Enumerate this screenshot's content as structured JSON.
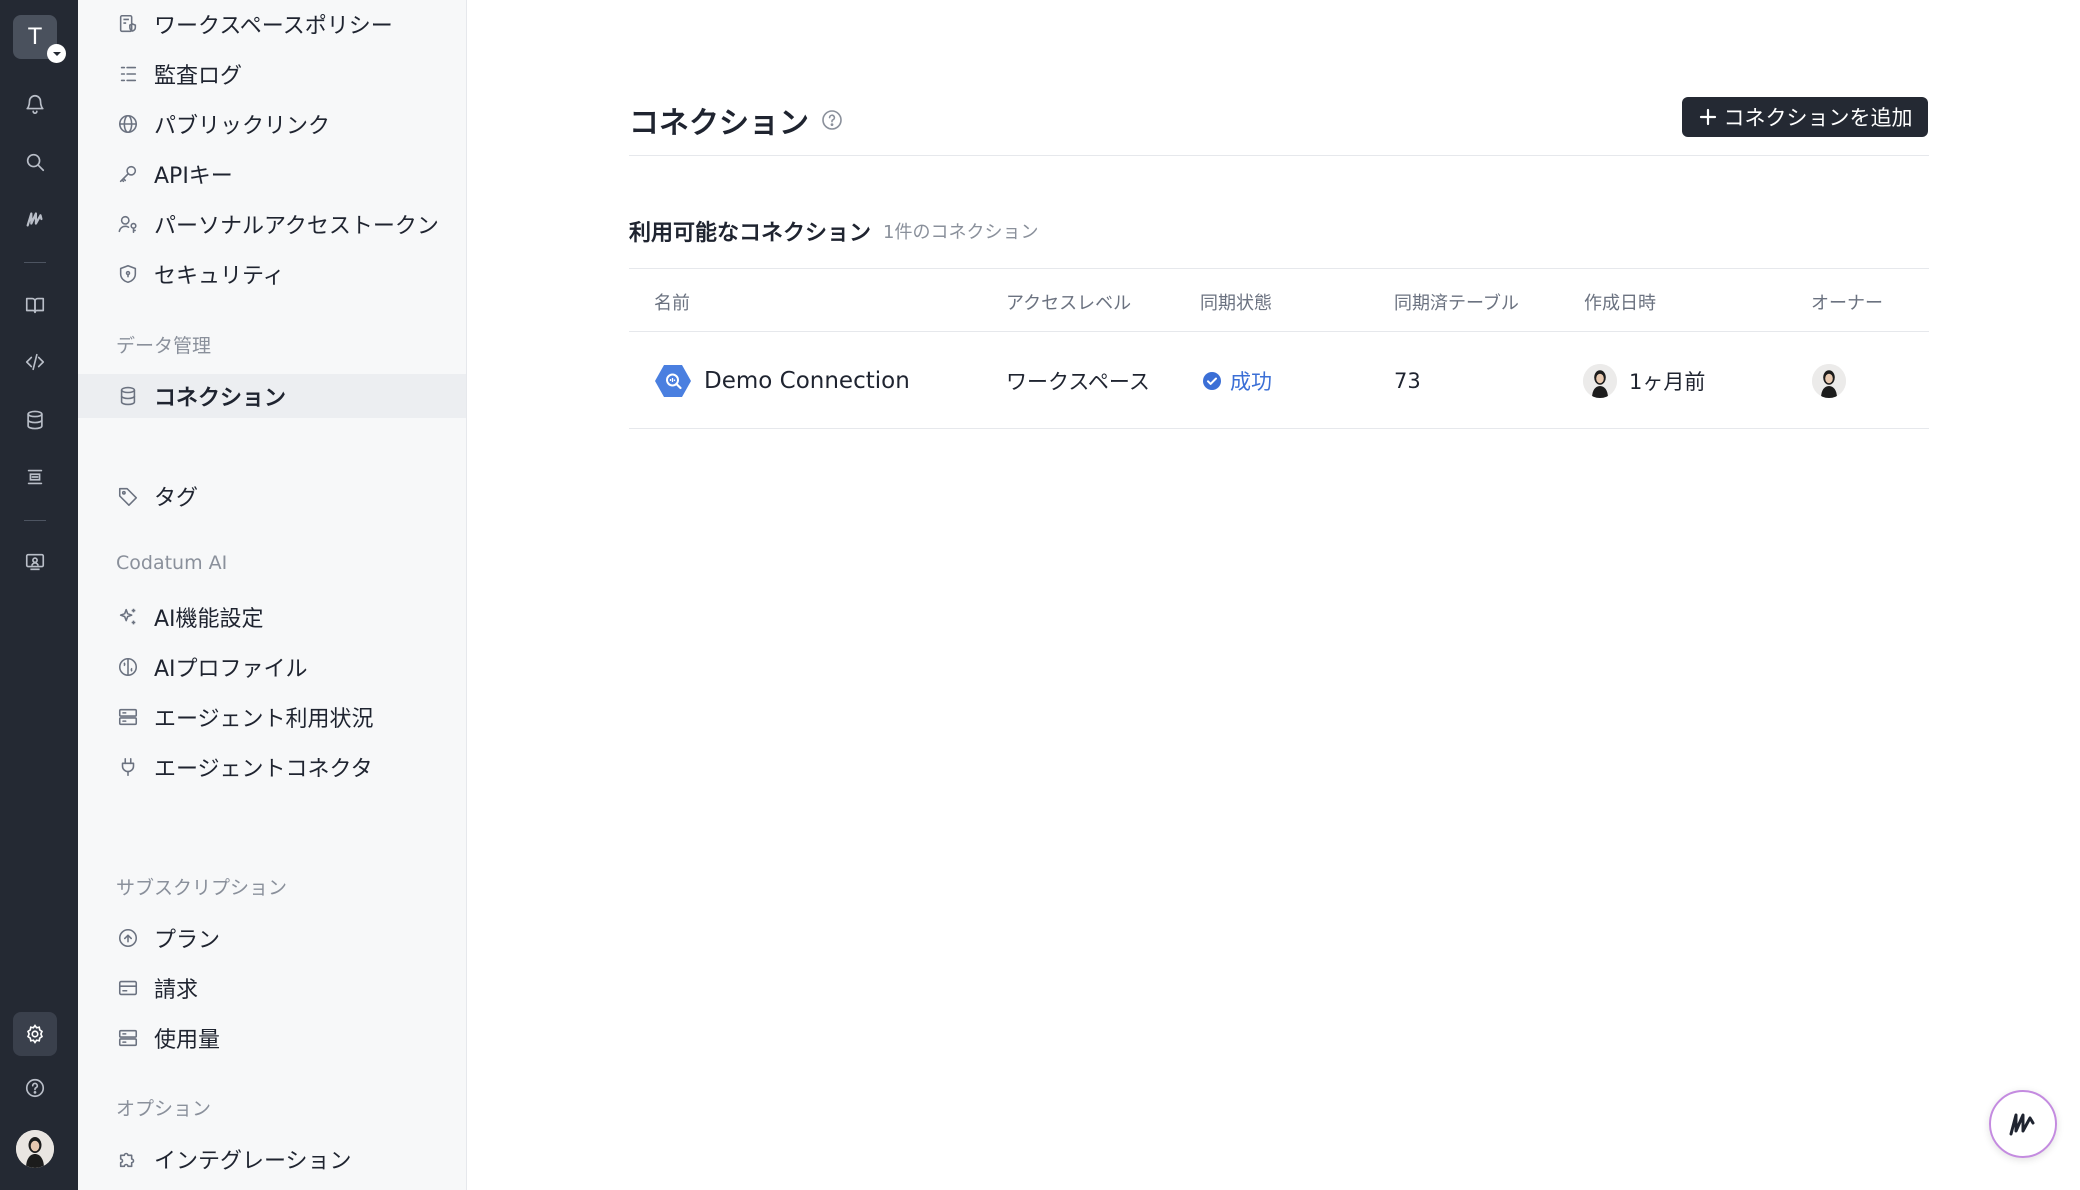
{
  "rail": {
    "workspace_initial": "T",
    "items": [
      {
        "name": "notifications",
        "icon": "bell-icon"
      },
      {
        "name": "search",
        "icon": "search-icon"
      },
      {
        "name": "codatum-home",
        "icon": "codatum-logo-icon"
      },
      {
        "name": "notebooks",
        "icon": "book-icon"
      },
      {
        "name": "sql",
        "icon": "code-icon"
      },
      {
        "name": "data",
        "icon": "database-icon"
      },
      {
        "name": "dashboards",
        "icon": "layers-icon"
      },
      {
        "name": "reports",
        "icon": "presentation-icon"
      },
      {
        "name": "settings",
        "icon": "gear-icon"
      },
      {
        "name": "help",
        "icon": "help-circle-icon"
      }
    ]
  },
  "sidebar": {
    "items_top": [
      {
        "label": "ワークスペースポリシー",
        "icon": "policy-icon"
      },
      {
        "label": "監査ログ",
        "icon": "list-icon"
      },
      {
        "label": "パブリックリンク",
        "icon": "globe-icon"
      },
      {
        "label": "APIキー",
        "icon": "key-icon"
      },
      {
        "label": "パーソナルアクセストークン",
        "icon": "user-key-icon"
      },
      {
        "label": "セキュリティ",
        "icon": "shield-icon"
      }
    ],
    "data_section": {
      "label": "データ管理",
      "items": [
        {
          "label": "コネクション",
          "icon": "database-icon"
        },
        {
          "label": "タグ",
          "icon": "tag-icon"
        }
      ]
    },
    "ai_section": {
      "label": "Codatum AI",
      "items": [
        {
          "label": "AI機能設定",
          "icon": "sparkles-icon"
        },
        {
          "label": "AIプロファイル",
          "icon": "brain-icon"
        },
        {
          "label": "エージェント利用状況",
          "icon": "server-icon"
        },
        {
          "label": "エージェントコネクタ",
          "icon": "plug-icon"
        }
      ]
    },
    "subscription_section": {
      "label": "サブスクリプション",
      "items": [
        {
          "label": "プラン",
          "icon": "arrow-up-circle-icon"
        },
        {
          "label": "請求",
          "icon": "credit-card-icon"
        },
        {
          "label": "使用量",
          "icon": "server-icon"
        }
      ]
    },
    "options_section": {
      "label": "オプション",
      "items": [
        {
          "label": "インテグレーション",
          "icon": "puzzle-icon"
        }
      ]
    }
  },
  "main": {
    "title": "コネクション",
    "add_button": "コネクションを追加",
    "section_title": "利用可能なコネクション",
    "section_count": "1件のコネクション",
    "columns": [
      "名前",
      "アクセスレベル",
      "同期状態",
      "同期済テーブル",
      "作成日時",
      "オーナー"
    ],
    "rows": [
      {
        "name": "Demo Connection",
        "access_level": "ワークスペース",
        "sync_status": "成功",
        "synced_tables": "73",
        "created": "1ヶ月前",
        "source_icon": "bigquery-icon"
      }
    ]
  },
  "colors": {
    "rail_bg": "#242933",
    "sidebar_bg": "#f7f8f9",
    "primary_button": "#242933",
    "status_success": "#3b6fd6",
    "bigquery_blue": "#4a7fe0"
  }
}
